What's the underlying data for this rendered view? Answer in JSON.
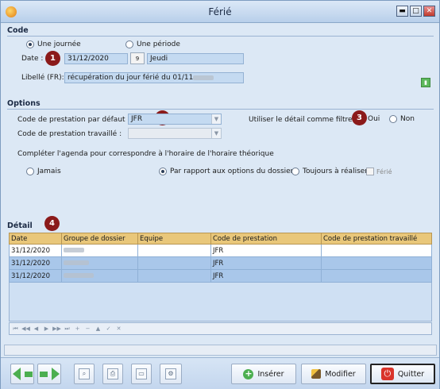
{
  "window": {
    "title": "Férié"
  },
  "code": {
    "section_title": "Code",
    "radio_journee": "Une journée",
    "radio_periode": "Une période",
    "date_label": "Date :",
    "date_value": "31/12/2020",
    "calendar_btn": "9",
    "day_value": "Jeudi",
    "libelle_label": "Libellé (FR):",
    "libelle_value": "récupération du jour férié du 01/11"
  },
  "options": {
    "section_title": "Options",
    "code_defaut_label": "Code de prestation par défaut :",
    "code_defaut_value": "JFR",
    "code_travaille_label": "Code de prestation travaillé :",
    "code_travaille_value": "",
    "filtre_label": "Utiliser le détail comme filtre :",
    "filtre_oui": "Oui",
    "filtre_non": "Non",
    "agenda_label": "Compléter l'agenda pour correspondre à l'horaire de l'horaire théorique",
    "radio_jamais": "Jamais",
    "radio_dossier": "Par rapport aux options du dossier",
    "radio_toujours": "Toujours à réaliser",
    "ferie_checkbox": "Férié"
  },
  "detail": {
    "section_title": "Détail",
    "columns": [
      "Date",
      "Groupe de dossier",
      "Equipe",
      "Code de prestation",
      "Code de prestation travaillé"
    ],
    "rows": [
      {
        "date": "31/12/2020",
        "groupe": "",
        "equipe": "",
        "code": "JFR",
        "code_travaille": ""
      },
      {
        "date": "31/12/2020",
        "groupe": "",
        "equipe": "",
        "code": "JFR",
        "code_travaille": ""
      },
      {
        "date": "31/12/2020",
        "groupe": "",
        "equipe": "",
        "code": "JFR",
        "code_travaille": ""
      }
    ]
  },
  "badges": [
    "1",
    "2",
    "3",
    "4"
  ],
  "toolbar": {
    "inserer": "Insérer",
    "modifier": "Modifier",
    "quitter": "Quitter"
  },
  "colors": {
    "field_blue": "#c4daf1",
    "header_gold": "#e9c77a",
    "selected_row": "#a9c7ea",
    "badge": "#8b1a1a",
    "green_arrow": "#4caf50"
  }
}
